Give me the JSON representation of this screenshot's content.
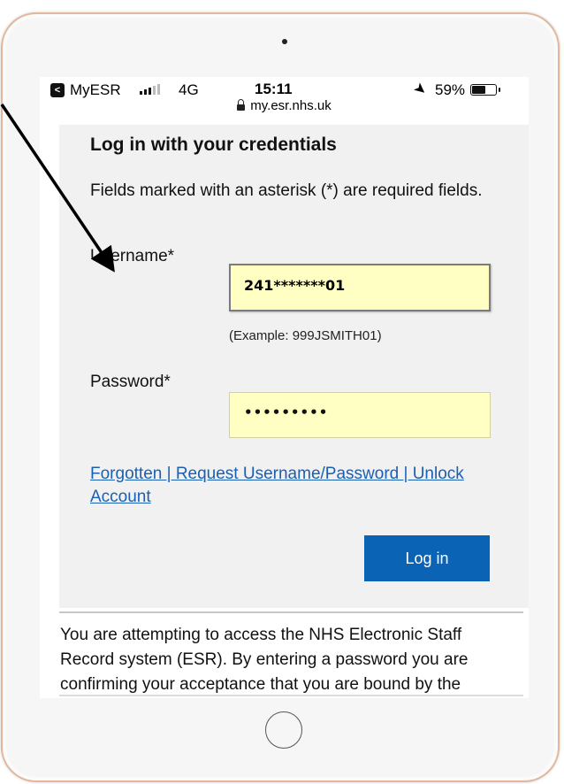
{
  "status_bar": {
    "back_app": "MyESR",
    "back_glyph": "<",
    "network": "4G",
    "time": "15:11",
    "location_glyph": "➤",
    "battery": "59%",
    "battery_level": 0.59
  },
  "address_bar": {
    "url": "my.esr.nhs.uk"
  },
  "login": {
    "heading": "Log in with your credentials",
    "intro": "Fields marked with an asterisk (*) are required fields.",
    "username_label": "Username*",
    "username_value": "241*******01",
    "username_hint": "(Example: 999JSMITH01)",
    "password_label": "Password*",
    "password_value": "•••••••••",
    "forgot_link": "Forgotten | Request Username/Password | Unlock Account",
    "login_button": "Log in"
  },
  "notice": {
    "text": "You are attempting to access the NHS Electronic Staff Record system (ESR). By entering a password you are confirming your acceptance that you are bound by the Computer"
  },
  "colors": {
    "frame_border": "#e2b79c",
    "input_fill": "#ffffc4",
    "link": "#1a5fb4",
    "button": "#0b63b6"
  }
}
